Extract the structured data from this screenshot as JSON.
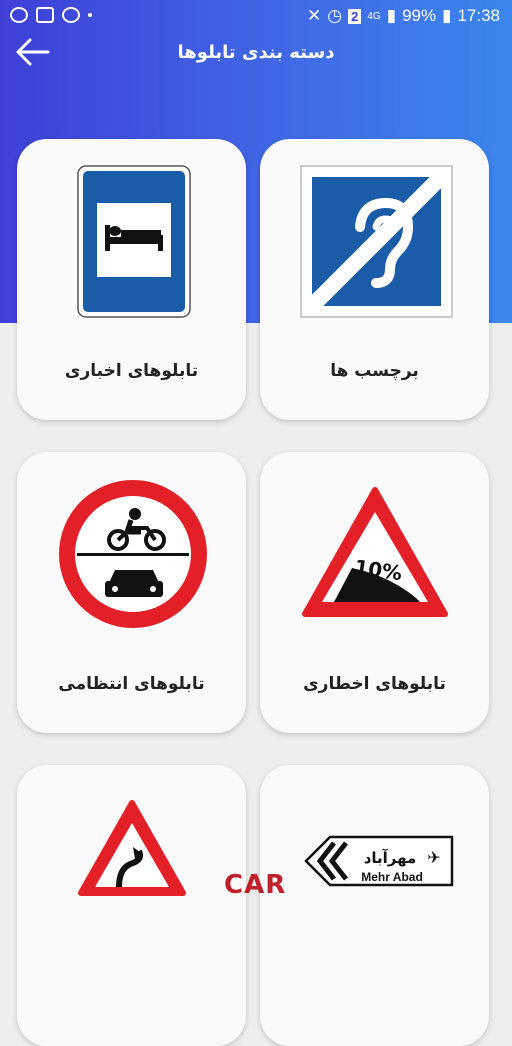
{
  "status_bar": {
    "battery": "99%",
    "time": "17:38",
    "network": "4G",
    "sim": "2"
  },
  "header": {
    "title": "دسته بندی تابلوها"
  },
  "categories": [
    {
      "label": "برچسب ها",
      "icon": "hearing-impaired-sign"
    },
    {
      "label": "تابلوهای اخباری",
      "icon": "hotel-bed-sign"
    },
    {
      "label": "تابلوهای اخطاری",
      "icon": "steep-descent-warning-sign",
      "sign_text": "10%"
    },
    {
      "label": "تابلوهای انتظامی",
      "icon": "no-motor-vehicles-sign"
    },
    {
      "label": "",
      "icon": "direction-sign",
      "sign_text_fa": "مهرآباد",
      "sign_text_en": "Mehr Abad"
    },
    {
      "label": "",
      "icon": "curve-warning-sign"
    }
  ],
  "watermark": "CAR",
  "colors": {
    "header_start": "#3f3fd6",
    "header_end": "#3c86ee",
    "sign_blue": "#1a5ca8",
    "sign_red": "#e32028"
  }
}
